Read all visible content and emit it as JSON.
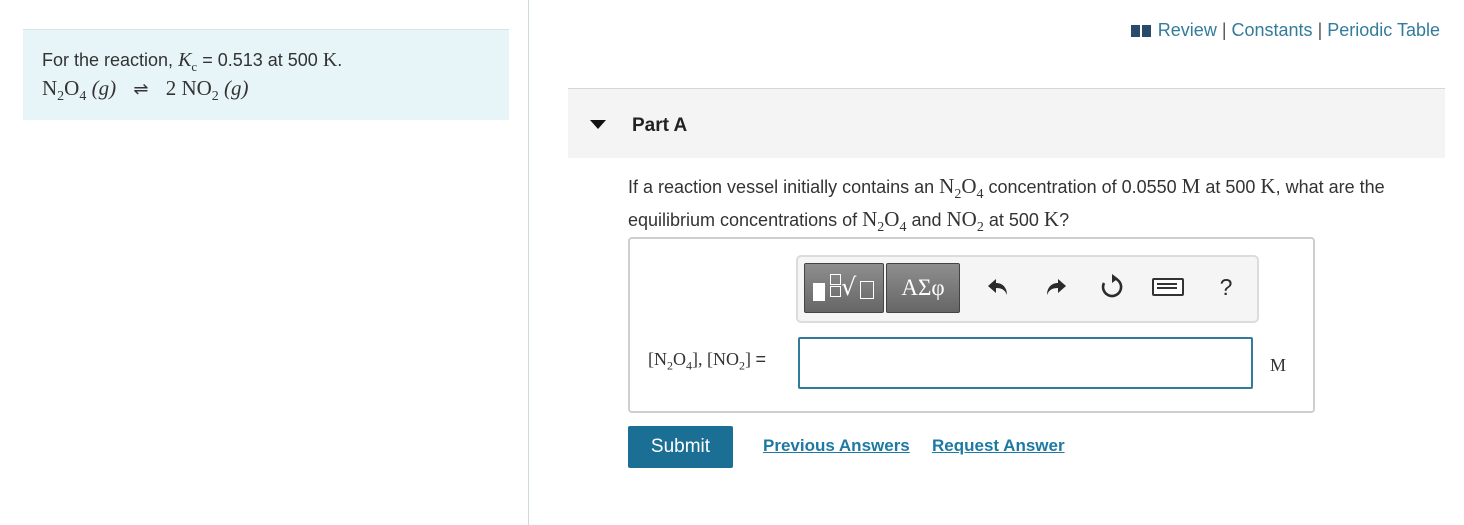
{
  "intro": {
    "prefix": "For the reaction, ",
    "k_symbol": "K",
    "k_sub": "c",
    "k_value_text": " = 0.513 at 500 ",
    "k_unit": "K",
    "k_period": ".",
    "reaction": {
      "reactant": "N",
      "reactant_sub1": "2",
      "reactant_o": "O",
      "reactant_sub2": "4",
      "reactant_state": "(g)",
      "arrow": "⇌",
      "product_coef": "2 NO",
      "product_sub": "2",
      "product_state": "(g)"
    }
  },
  "top_links": {
    "review": "Review",
    "constants": "Constants",
    "periodic_table": "Periodic Table",
    "separator": "|"
  },
  "part": {
    "title": "Part A"
  },
  "question": {
    "t1": "If a reaction vessel initially contains an ",
    "t2": " concentration of 0.0550 ",
    "t3": " at 500 ",
    "t4": ", what are the equilibrium concentrations of ",
    "t5": " and ",
    "t6": " at 500 ",
    "t7": "?",
    "unit_m": "M",
    "unit_k": "K",
    "n2o4": "N",
    "two": "2",
    "o": "O",
    "four": "4",
    "no": "NO"
  },
  "toolbar": {
    "greek_label": "ΑΣφ",
    "help_label": "?"
  },
  "answer": {
    "label_open1": "[N",
    "label_sub1": "2",
    "label_o": "O",
    "label_sub2": "4",
    "label_mid": "], [NO",
    "label_sub3": "2",
    "label_close": "] ",
    "label_eq": "=",
    "value": "",
    "unit": "M"
  },
  "actions": {
    "submit": "Submit",
    "previous_answers": "Previous Answers",
    "request_answer": "Request Answer"
  }
}
